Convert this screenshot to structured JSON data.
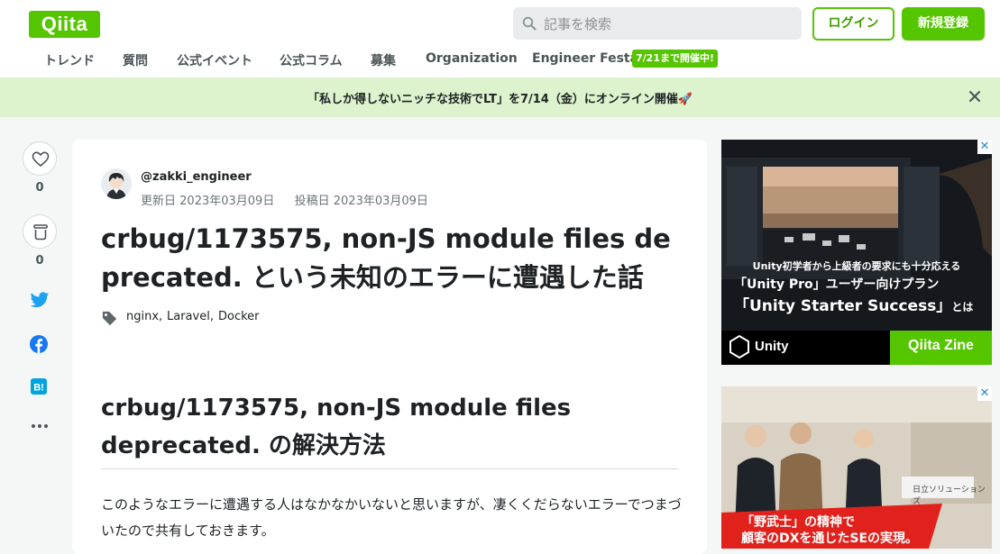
{
  "header": {
    "logo_text": "Qiita",
    "search_placeholder": "記事を検索",
    "login_label": "ログイン",
    "signup_label": "新規登録",
    "brand_color": "#55c500"
  },
  "nav": {
    "items": [
      "トレンド",
      "質問",
      "公式イベント",
      "公式コラム",
      "募集",
      "Organization",
      "Engineer Festa"
    ],
    "festa_badge": "7/21まで開催中!"
  },
  "banner": {
    "text": "「私しか得しないニッチな技術でLT」を7/14（金）にオンライン開催🚀"
  },
  "actions": {
    "like_count": "0",
    "stock_count": "0"
  },
  "article": {
    "author": "@zakki_engineer",
    "updated_label": "更新日",
    "updated_date": "2023年03月09日",
    "posted_label": "投稿日",
    "posted_date": "2023年03月09日",
    "title": "crbug/1173575, non-JS module files deprecated. という未知のエラーに遭遇した話",
    "tags": [
      "nginx",
      "Laravel",
      "Docker"
    ],
    "heading": "crbug/1173575, non-JS module files deprecated. の解決方法",
    "paragraph": "このようなエラーに遭遇する人はなかなかいないと思いますが、凄くくだらないエラーでつまづいたので共有しておきます。"
  },
  "ads": {
    "ad1": {
      "line1": "Unity初学者から上級者の要求にも十分応える",
      "line2": "「Unity Pro」ユーザー向けプラン",
      "line3": "「Unity Starter Success」",
      "line3_suffix": "とは",
      "brand_left": "Unity",
      "brand_right": "Qiita Zine"
    },
    "ad2": {
      "sign": "日立ソリューションズ",
      "line1": "「野武士」の精神で",
      "line2": "顧客のDXを通じたSEの実現。"
    }
  }
}
